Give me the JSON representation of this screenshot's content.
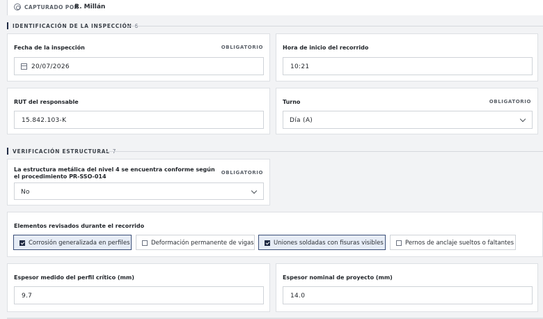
{
  "captured": {
    "label": "CAPTURADO POR",
    "name": "R. Millán"
  },
  "sections": {
    "identificacion": {
      "title": "IDENTIFICACIÓN DE LA INSPECCIÓN",
      "count": "6"
    },
    "verificacion": {
      "title": "VERIFICACIÓN ESTRUCTURAL",
      "count": "7"
    }
  },
  "required_label": "OBLIGATORIO",
  "fields": {
    "fecha": {
      "label": "Fecha de la inspección",
      "value": "20/07/2026"
    },
    "hora": {
      "label": "Hora de inicio del recorrido",
      "value": "10:21"
    },
    "rut": {
      "label": "RUT del responsable",
      "value": "15.842.103-K"
    },
    "turno": {
      "label": "Turno",
      "value": "Día (A)"
    },
    "conforme": {
      "label": "La estructura metálica del nivel 4 se encuentra conforme según el procedimiento PR-SSO-014",
      "value": "No"
    },
    "elementos": {
      "label": "Elementos revisados durante el recorrido",
      "options": [
        {
          "label": "Corrosión generalizada en perfiles",
          "checked": true
        },
        {
          "label": "Deformación permanente de vigas",
          "checked": false
        },
        {
          "label": "Uniones soldadas con fisuras visibles",
          "checked": true
        },
        {
          "label": "Pernos de anclaje sueltos o faltantes",
          "checked": false
        }
      ]
    },
    "espesor_medido": {
      "label": "Espesor medido del perfil crítico (mm)",
      "value": "9.7"
    },
    "espesor_nominal": {
      "label": "Espesor nominal de proyecto (mm)",
      "value": "14.0"
    }
  }
}
